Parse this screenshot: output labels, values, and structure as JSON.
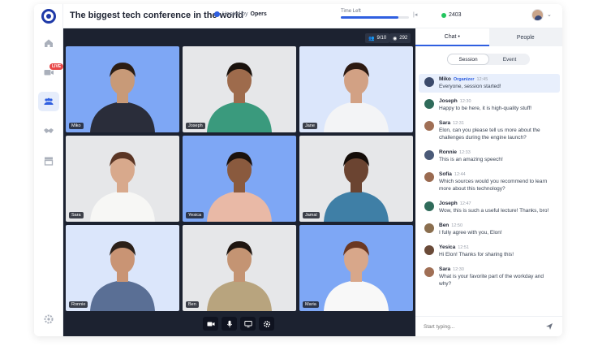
{
  "header": {
    "title": "The biggest tech conference in the world",
    "hosted_prefix": "Hosted by",
    "host": "Opers",
    "time_left_label": "Time Left",
    "time_progress": 0.85,
    "viewers": "2403"
  },
  "sidebar": {
    "live_badge": "LIVE",
    "items": [
      "home-icon",
      "live-icon",
      "people-icon",
      "handshake-icon",
      "store-icon"
    ],
    "settings_icon": "gear-icon"
  },
  "stage": {
    "participants_count": "9/10",
    "views": "292",
    "tiles": [
      {
        "name": "Miko",
        "bg": "blue",
        "shirt": "#2a2d3a",
        "skin": "#c89a78",
        "hair": "#2b1d14"
      },
      {
        "name": "Joseph",
        "bg": "gray",
        "shirt": "#3a9a7d",
        "skin": "#9e6b4c",
        "hair": "#1a120d"
      },
      {
        "name": "Jane",
        "bg": "lblue",
        "shirt": "#f3f4f6",
        "skin": "#d2a184",
        "hair": "#2c1a12"
      },
      {
        "name": "Sara",
        "bg": "gray",
        "shirt": "#f7f7f5",
        "skin": "#d8a98c",
        "hair": "#5a3524"
      },
      {
        "name": "Yesica",
        "bg": "blue",
        "shirt": "#e9b9a6",
        "skin": "#8a5a3e",
        "hair": "#1b120d"
      },
      {
        "name": "Jamal",
        "bg": "gray",
        "shirt": "#3f7fa6",
        "skin": "#6b4431",
        "hair": "#140d09"
      },
      {
        "name": "Ronnie",
        "bg": "lblue",
        "shirt": "#5a6f95",
        "skin": "#c99474",
        "hair": "#2b2019"
      },
      {
        "name": "Ben",
        "bg": "gray",
        "shirt": "#b8a47e",
        "skin": "#c49473",
        "hair": "#1e1510"
      },
      {
        "name": "Maria",
        "bg": "blue",
        "shirt": "#f8f8f8",
        "skin": "#d8a78a",
        "hair": "#6b3822"
      }
    ],
    "controls": [
      "camera-icon",
      "microphone-icon",
      "screen-share-icon",
      "settings-icon"
    ]
  },
  "chat": {
    "tabs": [
      {
        "label": "Chat •",
        "active": true
      },
      {
        "label": "People",
        "active": false
      }
    ],
    "segments": [
      {
        "label": "Session",
        "active": true
      },
      {
        "label": "Event",
        "active": false
      }
    ],
    "messages": [
      {
        "name": "Miko",
        "role": "Organizer",
        "time": "12:45",
        "text": "Everyone, session started!",
        "highlight": true,
        "avatar": "#3b4a6b"
      },
      {
        "name": "Joseph",
        "role": "",
        "time": "12:30",
        "text": "Happy to be here, it is high-quality stuff!",
        "highlight": false,
        "avatar": "#2f6b5a"
      },
      {
        "name": "Sara",
        "role": "",
        "time": "12:31",
        "text": "Elon, can you please tell us more about the challenges during the engine launch?",
        "highlight": false,
        "avatar": "#a06f55"
      },
      {
        "name": "Ronnie",
        "role": "",
        "time": "12:33",
        "text": "This is an amazing speech!",
        "highlight": false,
        "avatar": "#4a5a78"
      },
      {
        "name": "Sofia",
        "role": "",
        "time": "12:44",
        "text": "Which sources would you recommend to learn more about this technology?",
        "highlight": false,
        "avatar": "#9a6a50"
      },
      {
        "name": "Joseph",
        "role": "",
        "time": "12:47",
        "text": "Wow, this is such a useful lecture! Thanks, bro!",
        "highlight": false,
        "avatar": "#2f6b5a"
      },
      {
        "name": "Ben",
        "role": "",
        "time": "12:50",
        "text": "I fully agree with you, Elon!",
        "highlight": false,
        "avatar": "#8a6e4e"
      },
      {
        "name": "Yesica",
        "role": "",
        "time": "12:51",
        "text": "Hi Elon! Thanks for sharing this!",
        "highlight": false,
        "avatar": "#6a4a38"
      },
      {
        "name": "Sara",
        "role": "",
        "time": "12:30",
        "text": "What is your favorite part of the workday and why?",
        "highlight": false,
        "avatar": "#a06f55"
      }
    ],
    "composer_placeholder": "Start typing...",
    "send_icon": "send-icon"
  },
  "colors": {
    "accent": "#2f5fe0",
    "stage_bg": "#1c2230",
    "live": "#e84747"
  }
}
